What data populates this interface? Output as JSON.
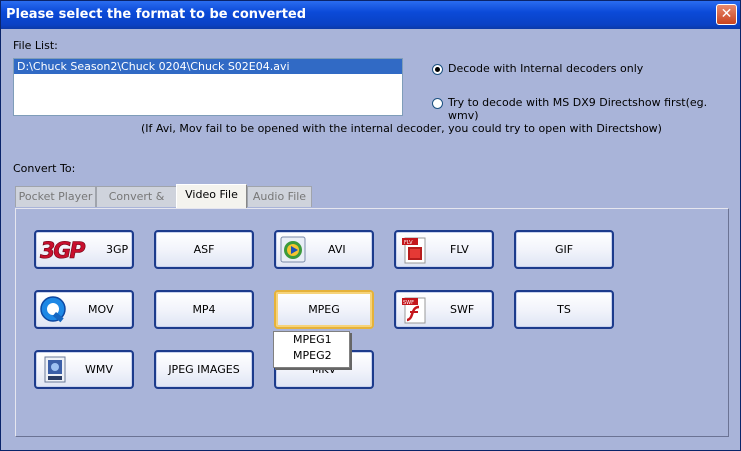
{
  "window": {
    "title": "Please select the format to be converted",
    "close_glyph": "✕"
  },
  "file_list": {
    "label": "File List:",
    "items": [
      "D:\\Chuck Season2\\Chuck 0204\\Chuck S02E04.avi"
    ]
  },
  "decode_options": {
    "internal_label": "Decode with Internal decoders only",
    "internal_selected": true,
    "directshow_label": "Try to decode with MS DX9 Directshow first(eg. wmv)",
    "directshow_selected": false
  },
  "hint": "(If Avi, Mov fail to be opened with the internal decoder, you could try to open with Directshow)",
  "convert_to": {
    "label": "Convert To:",
    "tabs": [
      "Pocket  Player",
      "Convert & Burn",
      "Video  File",
      "Audio   File"
    ],
    "active_tab": "Video  File"
  },
  "formats": [
    {
      "label": "3GP",
      "icon": "3gp-logo-icon"
    },
    {
      "label": "ASF",
      "icon": null
    },
    {
      "label": "AVI",
      "icon": "avi-media-icon"
    },
    {
      "label": "FLV",
      "icon": "flv-document-icon"
    },
    {
      "label": "GIF",
      "icon": null
    },
    {
      "label": "MOV",
      "icon": "quicktime-icon"
    },
    {
      "label": "MP4",
      "icon": null
    },
    {
      "label": "MPEG",
      "icon": null
    },
    {
      "label": "SWF",
      "icon": "flash-swf-icon"
    },
    {
      "label": "TS",
      "icon": null
    },
    {
      "label": "WMV",
      "icon": "wmv-media-icon"
    },
    {
      "label": "JPEG IMAGES",
      "icon": null
    },
    {
      "label": "MKV",
      "icon": null
    }
  ],
  "mpeg_menu": {
    "items": [
      "MPEG1",
      "MPEG2"
    ]
  },
  "colors": {
    "titlebar": "#0b4ad8",
    "dialog_bg": "#a9b4d9",
    "button_border": "#1c3b8c",
    "focus_border": "#e5b23a",
    "selection": "#316ac5"
  }
}
